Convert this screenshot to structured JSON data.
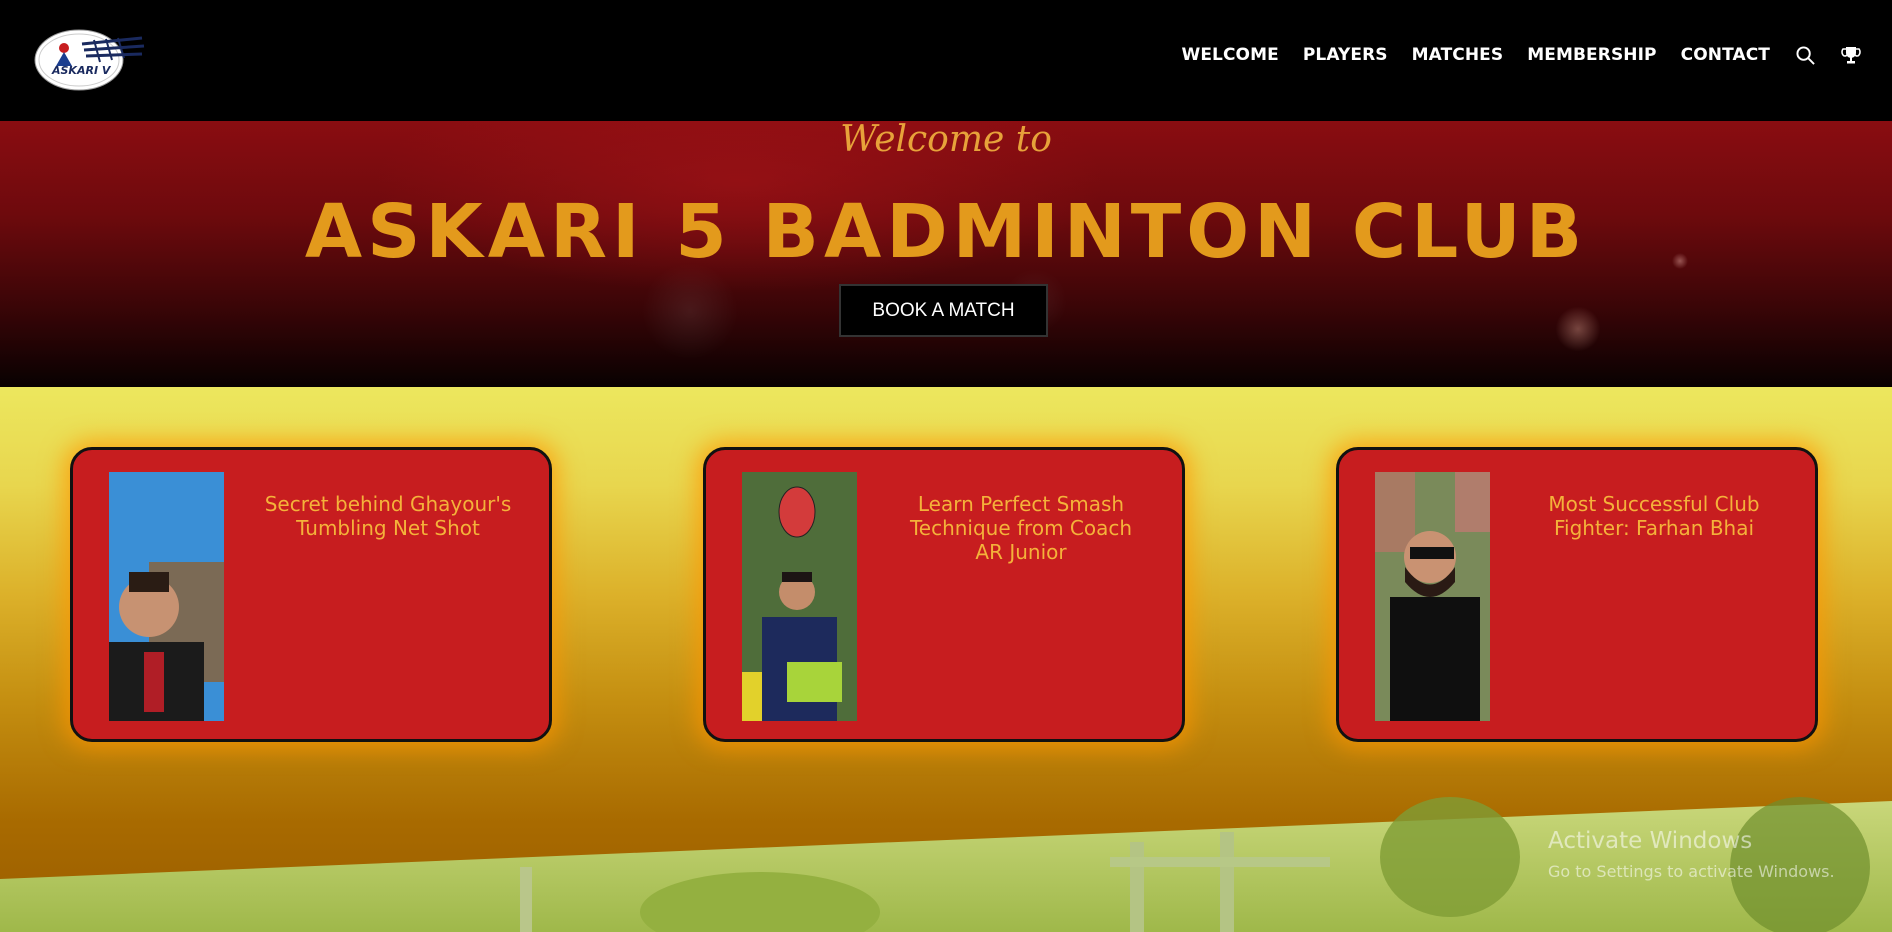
{
  "brand": {
    "logo_text": "ASKARI V"
  },
  "nav": {
    "items": [
      "WELCOME",
      "PLAYERS",
      "MATCHES",
      "MEMBERSHIP",
      "CONTACT"
    ],
    "search_icon": "search-icon",
    "trophy_icon": "trophy-icon"
  },
  "hero": {
    "pre_title": "Welcome to",
    "title": "ASKARI 5 BADMINTON CLUB",
    "button_label": "BOOK A MATCH"
  },
  "cards": [
    {
      "title": "Secret behind Ghayour's Tumbling Net Shot"
    },
    {
      "title": "Learn Perfect Smash Technique from Coach AR Junior"
    },
    {
      "title": "Most Successful Club Fighter: Farhan Bhai"
    }
  ],
  "watermark": {
    "title": "Activate Windows",
    "subtitle": "Go to Settings to activate Windows."
  },
  "colors": {
    "accent_gold": "#e39a1c",
    "card_red": "#c71d1f",
    "hero_red": "#8a0d11"
  }
}
